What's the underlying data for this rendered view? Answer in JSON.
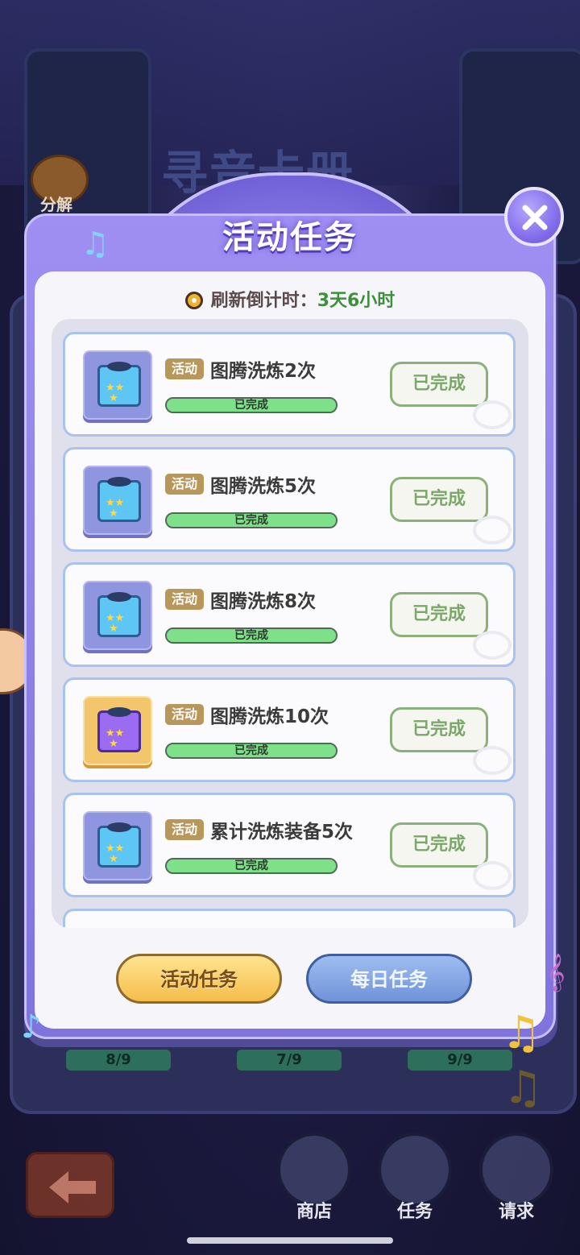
{
  "background": {
    "title": "寻音卡册",
    "decompose_label": "分解",
    "progress_labels": [
      "8/9",
      "7/9",
      "9/9"
    ]
  },
  "dialog": {
    "title": "活动任务",
    "countdown_label": "刷新倒计时：",
    "countdown_value": "3天6小时"
  },
  "tasks": [
    {
      "tag": "活动",
      "title": "图腾洗炼2次",
      "progress_text": "已完成",
      "progress": 1.0,
      "button": "已完成",
      "icon": "blue-music-box-icon"
    },
    {
      "tag": "活动",
      "title": "图腾洗炼5次",
      "progress_text": "已完成",
      "progress": 1.0,
      "button": "已完成",
      "icon": "blue-music-box-icon"
    },
    {
      "tag": "活动",
      "title": "图腾洗炼8次",
      "progress_text": "已完成",
      "progress": 1.0,
      "button": "已完成",
      "icon": "blue-music-box-icon"
    },
    {
      "tag": "活动",
      "title": "图腾洗炼10次",
      "progress_text": "已完成",
      "progress": 1.0,
      "button": "已完成",
      "icon": "gold-music-box-icon"
    },
    {
      "tag": "活动",
      "title": "累计洗炼装备5次",
      "progress_text": "已完成",
      "progress": 1.0,
      "button": "已完成",
      "icon": "blue-music-box-icon"
    }
  ],
  "tabs": {
    "activity": "活动任务",
    "daily": "每日任务"
  },
  "nav": {
    "shop": "商店",
    "tasks": "任务",
    "request": "请求"
  },
  "colors": {
    "accent_purple": "#7f73de",
    "complete_green": "#7fe08a",
    "countdown_green": "#3f8f3c",
    "tag_brown": "#b9975b",
    "tab_gold": "#f4bd4a",
    "tab_blue": "#6f93d8"
  }
}
